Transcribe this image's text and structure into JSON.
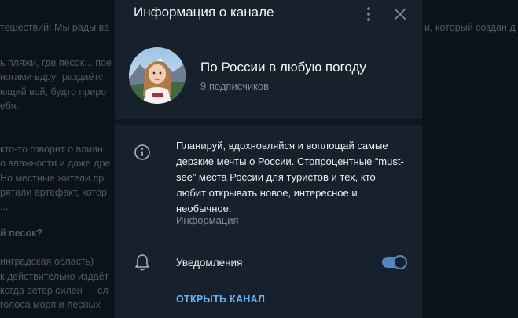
{
  "background_chat": {
    "lines": [
      "тешествий!  Мы рады ва",
      "и, который создан д",
      "ь пляжи, где песок... пое",
      "ногами вдруг раздаётс",
      "ющий вой, будто приро",
      "ебя.",
      "кто-то говорит о влиян",
      "о влажности и даже дре",
      "Но местные жители пр",
      "рятали артефакт, котор",
      "...",
      "й песок?",
      "инградская область)",
      "к действительно издаёт",
      "когда ветер силён — сл",
      "голоса моря и лесных"
    ]
  },
  "modal": {
    "title": "Информация о канале",
    "channel_name": "По России в любую погоду",
    "subscribers": "9 подписчиков",
    "description": "Планируй, вдохновляйся и воплощай самые дерзкие мечты о России. Стопроцентные “must-see” места России для туристов и тех, кто любит открывать новое, интересное и необычное.",
    "description_label": "Информация",
    "notifications_label": "Уведомления",
    "notifications_enabled": true,
    "open_channel_label": "ОТКРЫТЬ КАНАЛ"
  },
  "colors": {
    "accent": "#5288c1",
    "link": "#6ab2f2",
    "panel": "#17212b",
    "background": "#0e1621"
  },
  "icons": [
    "more-vertical-icon",
    "close-icon",
    "info-icon",
    "bell-icon"
  ]
}
